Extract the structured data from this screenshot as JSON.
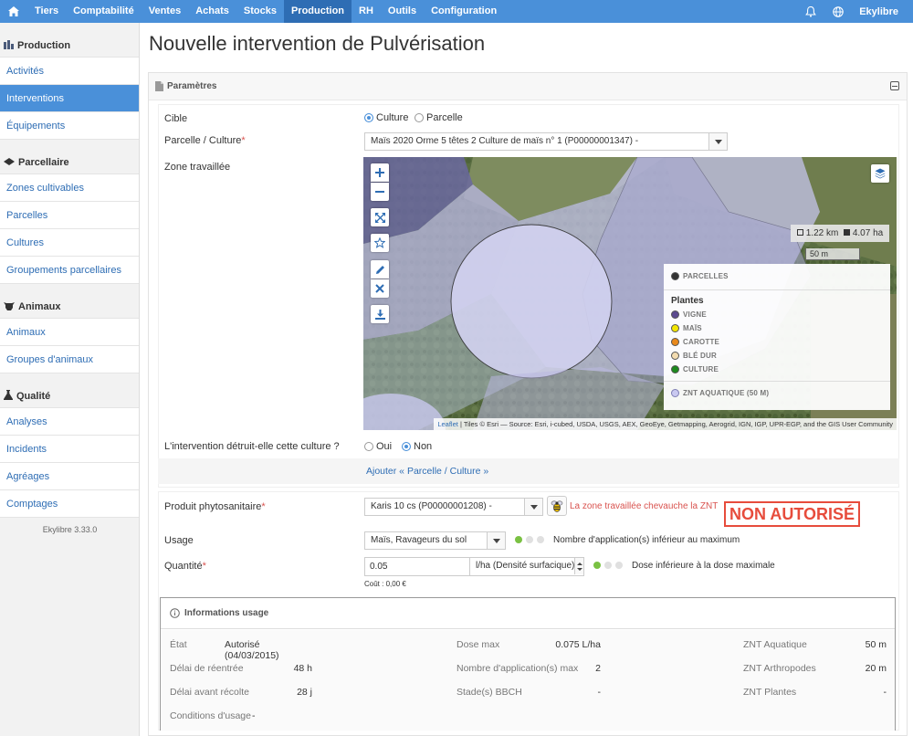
{
  "topnav": {
    "items": [
      {
        "label": "Tiers",
        "active": false
      },
      {
        "label": "Comptabilité",
        "active": false
      },
      {
        "label": "Ventes",
        "active": false
      },
      {
        "label": "Achats",
        "active": false
      },
      {
        "label": "Stocks",
        "active": false
      },
      {
        "label": "Production",
        "active": true
      },
      {
        "label": "RH",
        "active": false
      },
      {
        "label": "Outils",
        "active": false
      },
      {
        "label": "Configuration",
        "active": false
      }
    ],
    "user": "Ekylibre",
    "accent": "#4a90d9",
    "accent_active": "#2e6db4"
  },
  "sidebar": {
    "sections": [
      {
        "title": "Production",
        "icon": "production-icon",
        "items": [
          "Activités",
          "Interventions",
          "Équipements"
        ]
      },
      {
        "title": "Parcellaire",
        "icon": "parcel-icon",
        "items": [
          "Zones cultivables",
          "Parcelles",
          "Cultures",
          "Groupements parcellaires"
        ]
      },
      {
        "title": "Animaux",
        "icon": "cow-icon",
        "items": [
          "Animaux",
          "Groupes d'animaux"
        ]
      },
      {
        "title": "Qualité",
        "icon": "flask-icon",
        "items": [
          "Analyses",
          "Incidents",
          "Agréages",
          "Comptages"
        ]
      }
    ],
    "active_item": "Interventions",
    "version": "Ekylibre 3.33.0"
  },
  "page": {
    "title": "Nouvelle intervention de Pulvérisation"
  },
  "params": {
    "header": "Paramètres",
    "cible_label": "Cible",
    "cible_option1": "Culture",
    "cible_option2": "Parcelle",
    "parcelle_label": "Parcelle / Culture",
    "parcelle_value": "Maïs 2020 Orme 5 têtes 2 Culture de maïs n° 1 (P00000001347) -",
    "zone_label": "Zone travaillée",
    "destroy_label": "L'intervention détruit-elle cette culture ?",
    "destroy_yes": "Oui",
    "destroy_no": "Non",
    "add_link": "Ajouter « Parcelle / Culture »"
  },
  "map": {
    "measure_km": "1.22 km",
    "measure_ha": "4.07 ha",
    "scale": "50 m",
    "legend_parcelles": "PARCELLES",
    "legend_plantes_title": "Plantes",
    "legend_plantes": [
      {
        "label": "VIGNE",
        "color": "#5b4a8f"
      },
      {
        "label": "MAÏS",
        "color": "#f2e600"
      },
      {
        "label": "CAROTTE",
        "color": "#e8891c"
      },
      {
        "label": "BLÉ DUR",
        "color": "#f3dcb0"
      },
      {
        "label": "CULTURE",
        "color": "#1e8a1e"
      }
    ],
    "legend_znt": "ZNT AQUATIQUE (50 M)",
    "leaflet": "Leaflet",
    "attribution": "| Tiles © Esri — Source: Esri, i-cubed, USDA, USGS, AEX, GeoEye, Getmapping, Aerogrid, IGN, IGP, UPR-EGP, and the GIS User Community"
  },
  "product": {
    "label": "Produit phytosanitaire",
    "value": "Karis 10 cs (P00000001208) -",
    "warning": "La zone travaillée chevauche la ZNT",
    "badge": "NON AUTORISÉ",
    "usage_label": "Usage",
    "usage_value": "Maïs, Ravageurs du sol",
    "usage_status": "Nombre d'application(s) inférieur au maximum",
    "qty_label": "Quantité",
    "qty_value": "0.05",
    "qty_unit": "l/ha (Densité surfacique)",
    "qty_status": "Dose inférieure à la dose maximale",
    "cost": "Coût : 0,00 €"
  },
  "info": {
    "title": "Informations usage",
    "rows": [
      {
        "k1": "État",
        "v1": "Autorisé (04/03/2015)",
        "k2": "Dose max",
        "v2": "0.075 L/ha",
        "k3": "ZNT Aquatique",
        "v3": "50 m"
      },
      {
        "k1": "Délai de réentrée",
        "v1": "48 h",
        "k2": "Nombre d'application(s) max",
        "v2": "2",
        "k3": "ZNT Arthropodes",
        "v3": "20 m"
      },
      {
        "k1": "Délai avant récolte",
        "v1": "28 j",
        "k2": "Stade(s) BBCH",
        "v2": "-",
        "k3": "ZNT Plantes",
        "v3": "-"
      }
    ],
    "conditions_label": "Conditions d'usage",
    "conditions_value": "-"
  }
}
